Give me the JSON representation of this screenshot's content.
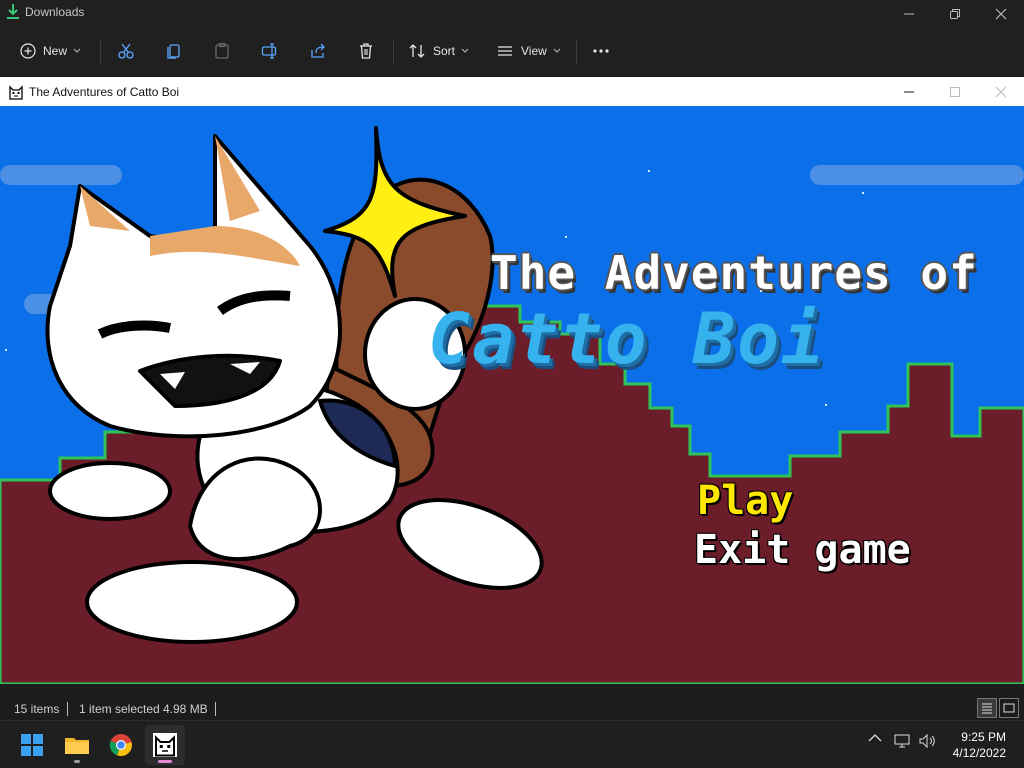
{
  "explorer": {
    "title": "Downloads",
    "toolbar": {
      "new_label": "New",
      "sort_label": "Sort",
      "view_label": "View"
    }
  },
  "game_window": {
    "title": "The Adventures of Catto Boi"
  },
  "game": {
    "title_line1": "The Adventures of",
    "title_line2": "Catto Boi",
    "menu": [
      {
        "label": "Play",
        "selected": true
      },
      {
        "label": "Exit game",
        "selected": false
      }
    ],
    "colors": {
      "sky": "#0a6fe8",
      "ground": "#6b1e2a",
      "grass": "#2ec45a",
      "title_blue": "#36b2ee",
      "selected_item": "#ffe800"
    }
  },
  "status": {
    "item_count": "15 items",
    "selection": "1 item selected",
    "size": "4.98 MB"
  },
  "taskbar": {
    "apps": [
      "windows-start",
      "file-explorer",
      "chrome",
      "catto-boi-game"
    ],
    "time": "9:25 PM",
    "date": "4/12/2022"
  }
}
